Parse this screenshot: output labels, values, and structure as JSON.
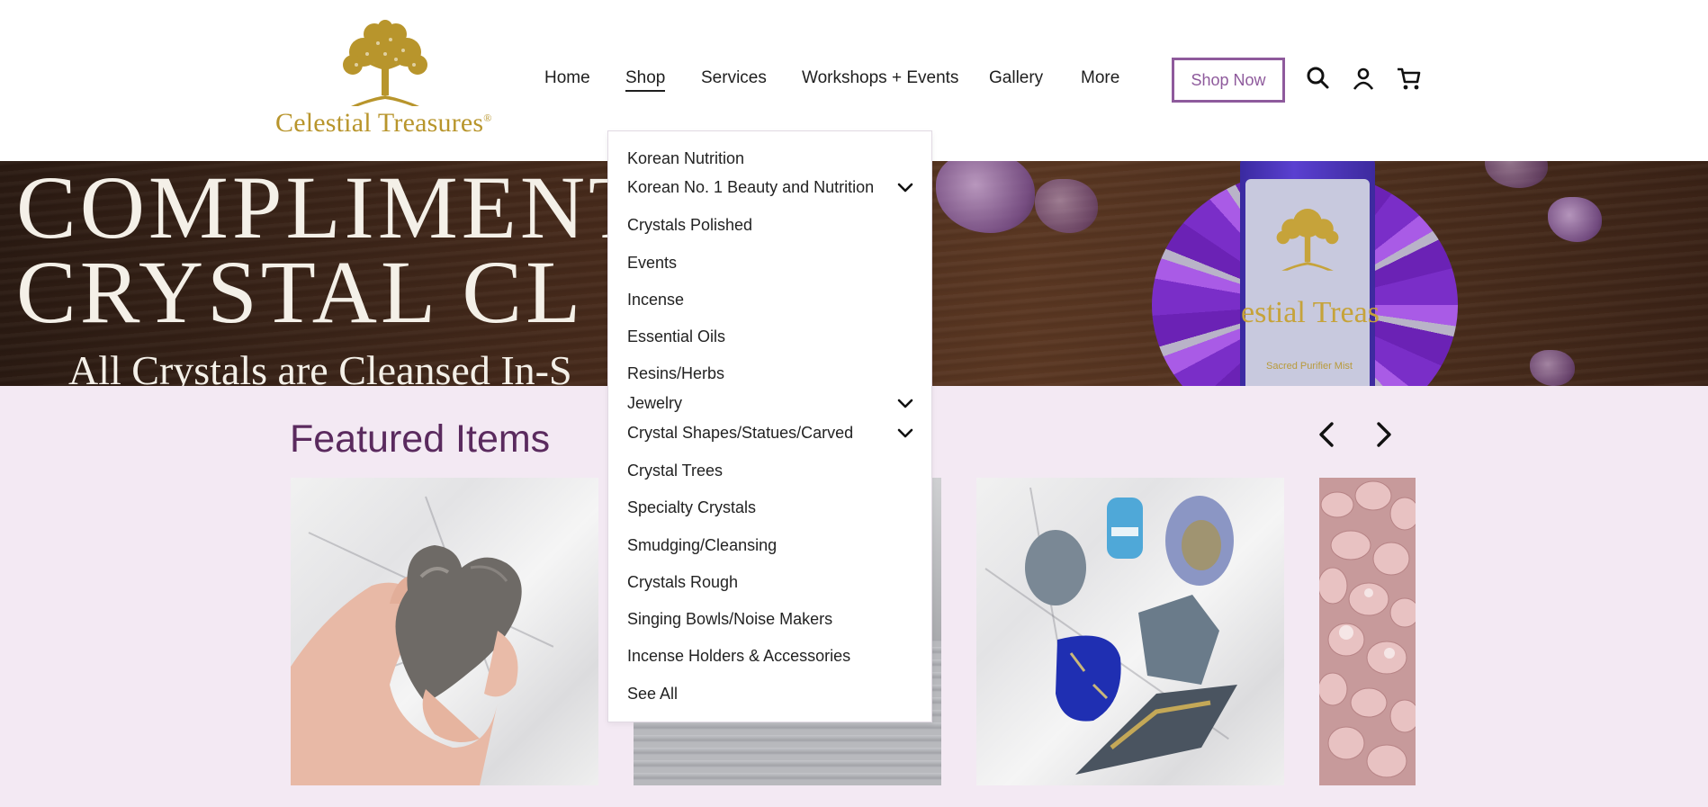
{
  "brand": {
    "logo_text": "Celestial Treasures",
    "trademark": "®",
    "logo_color": "#b8952c"
  },
  "nav": {
    "items": [
      {
        "label": "Home"
      },
      {
        "label": "Shop",
        "active": true
      },
      {
        "label": "Services"
      },
      {
        "label": "Workshops + Events"
      },
      {
        "label": "Gallery"
      },
      {
        "label": "More"
      }
    ],
    "cta_label": "Shop Now",
    "cta_color": "#8e5a9c",
    "icons": [
      "search-icon",
      "account-icon",
      "cart-icon"
    ]
  },
  "banner": {
    "line1": "COMPLIMENT",
    "line2": "CRYSTAL CL",
    "line3": "All Crystals are Cleansed In-S",
    "bottle_text": "estial Treas",
    "bottle_subtext": "Sacred Purifier Mist"
  },
  "featured": {
    "title": "Featured Items",
    "title_color": "#5a2a5e",
    "prev_icon": "chevron-left-icon",
    "next_icon": "chevron-right-icon"
  },
  "shop_menu": {
    "items": [
      {
        "label": "Korean Nutrition",
        "has_submenu": false
      },
      {
        "label": "Korean No. 1 Beauty and Nutrition",
        "has_submenu": true
      },
      {
        "label": "Crystals Polished",
        "has_submenu": false
      },
      {
        "label": "Events",
        "has_submenu": false
      },
      {
        "label": "Incense",
        "has_submenu": false
      },
      {
        "label": "Essential Oils",
        "has_submenu": false
      },
      {
        "label": "Resins/Herbs",
        "has_submenu": false
      },
      {
        "label": "Jewelry",
        "has_submenu": true
      },
      {
        "label": "Crystal Shapes/Statues/Carved",
        "has_submenu": true
      },
      {
        "label": "Crystal Trees",
        "has_submenu": false
      },
      {
        "label": "Specialty Crystals",
        "has_submenu": false
      },
      {
        "label": "Smudging/Cleansing",
        "has_submenu": false
      },
      {
        "label": "Crystals Rough",
        "has_submenu": false
      },
      {
        "label": "Singing Bowls/Noise Makers",
        "has_submenu": false
      },
      {
        "label": "Incense Holders & Accessories",
        "has_submenu": false
      },
      {
        "label": "See All",
        "has_submenu": false
      }
    ]
  },
  "colors": {
    "page_background": "#f3e9f3",
    "header_background": "#ffffff"
  }
}
